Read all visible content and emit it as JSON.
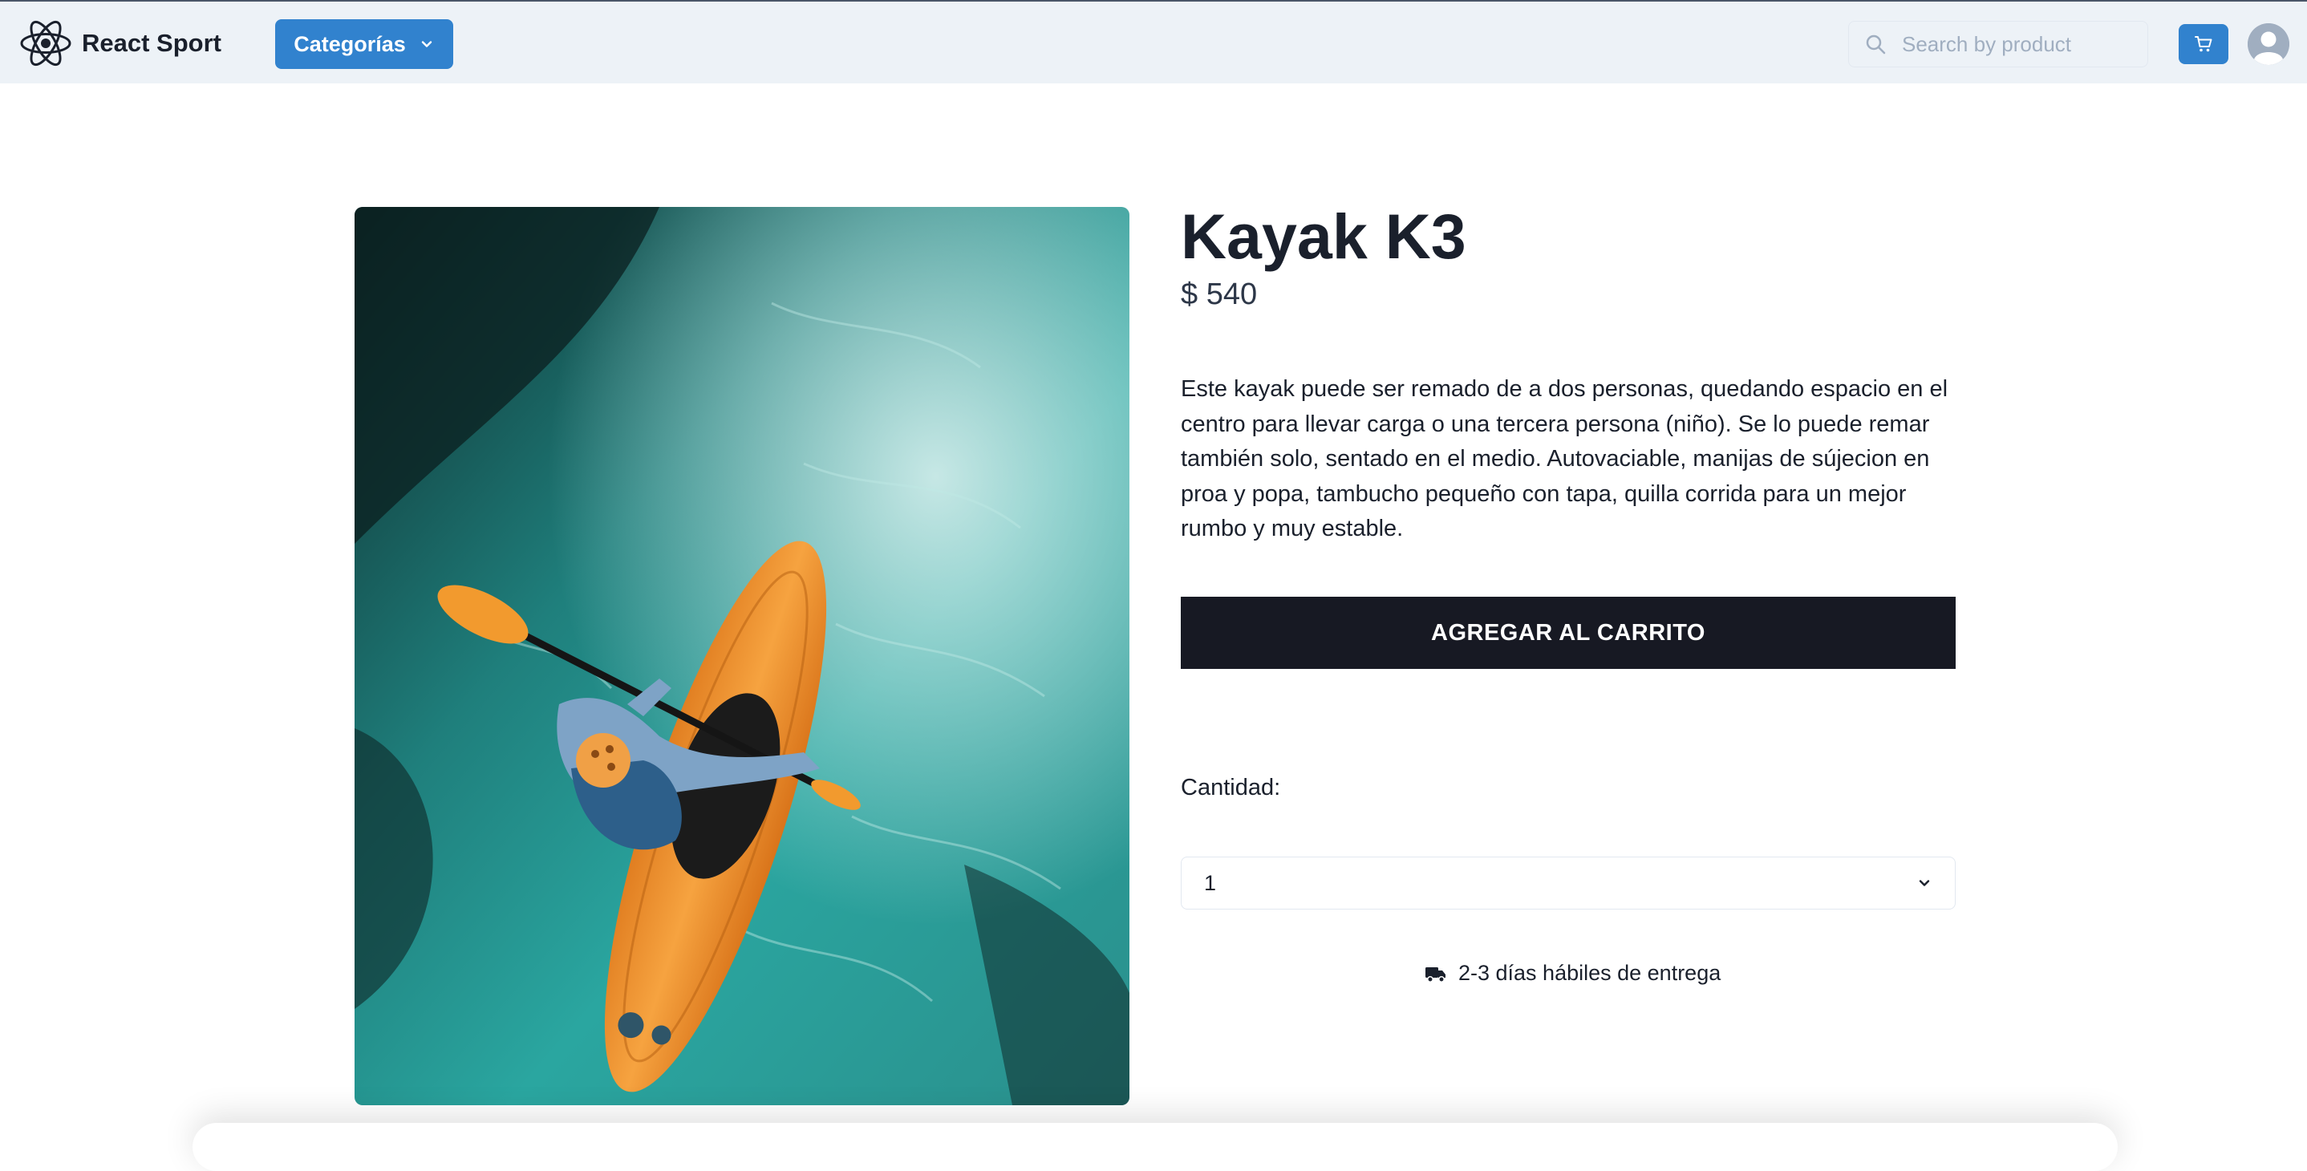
{
  "header": {
    "brand_name": "React Sport",
    "brand_icon": "react-atom-icon",
    "categories_label": "Categorías",
    "search_placeholder": "Search by product",
    "search_value": "",
    "cart_icon": "cart-icon",
    "avatar_icon": "user-avatar-icon"
  },
  "product": {
    "image_subject": "kayak-photo",
    "title": "Kayak K3",
    "price": "$ 540",
    "description": "Este kayak puede ser remado de a dos personas, quedando espacio en el centro para llevar carga o una tercera persona (niño). Se lo puede remar también solo, sentado en el medio. Autovaciable, manijas de sújecion en proa y popa, tambucho pequeño con tapa, quilla corrida para un mejor rumbo y muy estable.",
    "add_to_cart_label": "AGREGAR AL CARRITO",
    "quantity_label": "Cantidad:",
    "quantity_value": "1",
    "delivery_icon": "truck-icon",
    "delivery_text": "2-3 días hábiles de entrega"
  },
  "colors": {
    "primary": "#3182ce",
    "dark_button": "#171923",
    "nav_bg": "#edf2f7",
    "text": "#1a202c"
  }
}
